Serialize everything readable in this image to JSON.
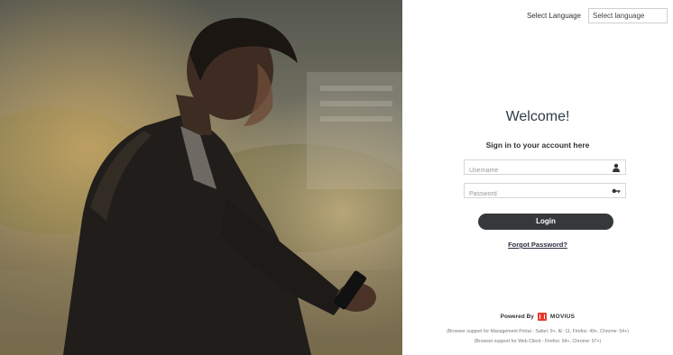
{
  "language": {
    "label": "Select Language",
    "selected": "Select language"
  },
  "login": {
    "title": "Welcome!",
    "subtitle": "Sign in to your account here",
    "username_placeholder": "Username",
    "password_placeholder": "Password",
    "login_label": "Login",
    "forgot_label": "Forgot Password?"
  },
  "footer": {
    "powered_by": "Powered By",
    "brand": "MOVIUS",
    "support_management": "(Browser support for Management Portal - Safari: 9+, IE: 11, Firefox: 49+, Chrome: 54+)",
    "support_web": "(Browser support for Web Client - Firefox: 94+, Chrome: 97+)"
  },
  "icons": {
    "username": "user-icon",
    "password": "key-icon",
    "brand": "movius-logo-icon"
  },
  "colors": {
    "button_bg": "#35393c",
    "title": "#2f3a47",
    "brand_red": "#e6392c"
  }
}
